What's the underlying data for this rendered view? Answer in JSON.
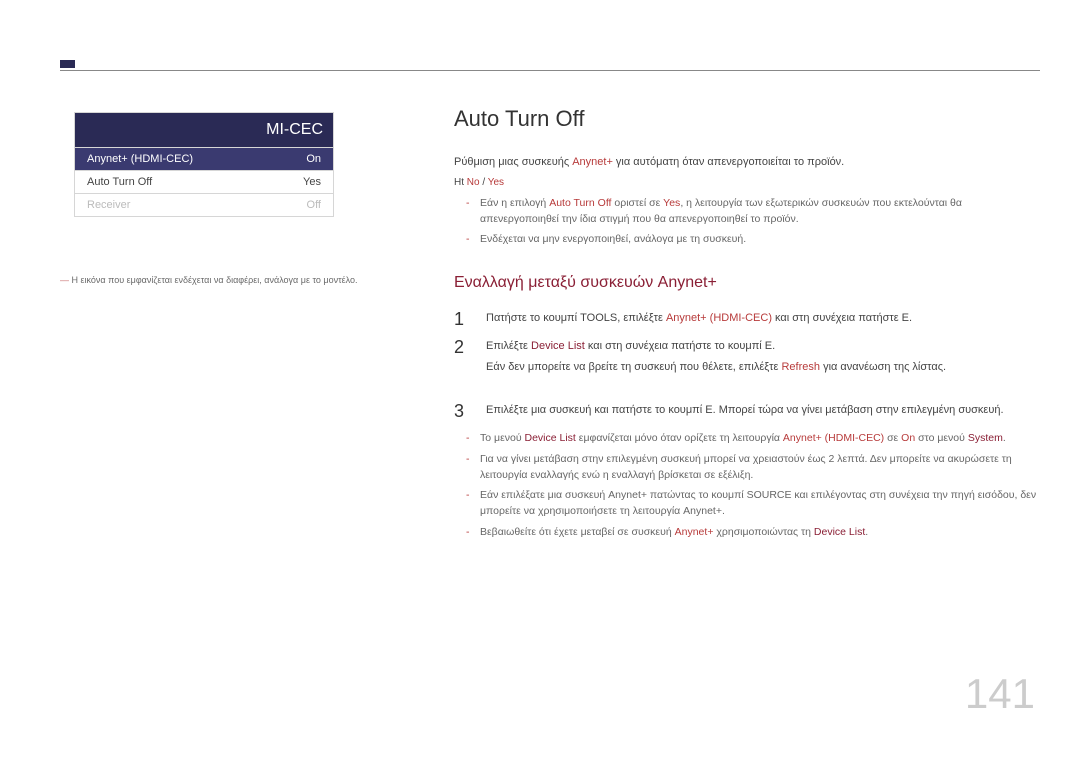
{
  "ui": {
    "title_suffix": "MI-CEC",
    "rows": [
      {
        "label": "Anynet+ (HDMI-CEC)",
        "value": "On",
        "selected": true
      },
      {
        "label": "Auto Turn Off",
        "value": "Yes",
        "selected": false
      },
      {
        "label": "Receiver",
        "value": "Off",
        "selected": false,
        "disabled": true
      }
    ]
  },
  "caption": {
    "prefix": "―",
    "text": "Η εικόνα που εμφανίζεται ενδέχεται να διαφέρει, ανάλογα με το μοντέλο."
  },
  "section1": {
    "heading": "Auto Turn Off",
    "para1_a": "Ρύθμιση μιας συσκευής ",
    "para1_red": "Anynet+",
    "para1_b": " για αυτόματη ",
    "para1_red2": "",
    "para1_c": "όταν απενεργοποιείται το προϊόν.",
    "para2_a": "Ht ",
    "para2_red": "No",
    "para2_b": " / ",
    "para2_red2": "Yes",
    "bullets": [
      {
        "a": "Εάν η επιλογή ",
        "red1": "Auto Turn Off",
        "b": " οριστεί σε ",
        "red2": "Yes",
        "c": ", η λειτουργία των εξωτερικών συσκευών που εκτελούνται θα απενεργοποιηθεί την ίδια στιγμή που θα απενεργοποιηθεί το προϊόν."
      },
      {
        "plain": "Ενδέχεται να μην ενεργοποιηθεί, ανάλογα με τη συσκευή."
      }
    ]
  },
  "section2": {
    "heading": "Εναλλαγή μεταξύ συσκευών Anynet+",
    "steps": [
      {
        "num": "1",
        "a": "Πατήστε το κουμπί ",
        "b": "TOOLS",
        "c": ", επιλέξτε ",
        "red1": "Anynet+ (HDMI-CEC)",
        "d": " και στη συνέχεια πατήστε ",
        "e": "E",
        "f": "."
      },
      {
        "num": "2",
        "a": "Επιλέξτε ",
        "red1": "Device List",
        "b": " και στη συνέχεια πατήστε το κουμπί ",
        "c": "E",
        "d": ".",
        "sub_a": "Εάν δεν μπορείτε να βρείτε τη συσκευή που θέλετε, επιλέξτε ",
        "sub_red": "Refresh",
        "sub_b": " για ανανέωση της λίστας."
      },
      {
        "num": "3",
        "a": "Επιλέξτε μια συσκευή και πατήστε το κουμπί ",
        "b": "E",
        "c": ". Μπορεί τώρα να γίνει μετάβαση στην επιλεγμένη συσκευή."
      }
    ],
    "notes": [
      {
        "a": "Το μενού ",
        "red1": "Device List",
        "b": " εμφανίζεται μόνο όταν ορίζετε τη λειτουργία ",
        "red2": "Anynet+ (HDMI-CEC)",
        "c": " σε ",
        "red3": "On",
        "d": " στο μενού ",
        "red4": "System",
        "e": "."
      },
      {
        "plain": "Για να γίνει μετάβαση στην επιλεγμένη συσκευή μπορεί να χρειαστούν έως 2 λεπτά. Δεν μπορείτε να ακυρώσετε τη λειτουργία εναλλαγής ενώ η εναλλαγή βρίσκεται σε εξέλιξη."
      },
      {
        "plain2a": "Εάν επιλέξατε μια συσκευή Anynet+ πατώντας το κουμπί ",
        "plain2b": "SOURCE",
        "plain2c": " και επιλέγοντας στη συνέχεια την πηγή εισόδου, δεν μπορείτε να χρησιμοποιήσετε τη λειτουργία Anynet+."
      },
      {
        "a": "Βεβαιωθείτε ότι έχετε μεταβεί σε συσκευή ",
        "red1": "Anynet+",
        "b": " χρησιμοποιώντας τη ",
        "red2": "Device List",
        "c": "."
      }
    ]
  },
  "page_number": "141"
}
